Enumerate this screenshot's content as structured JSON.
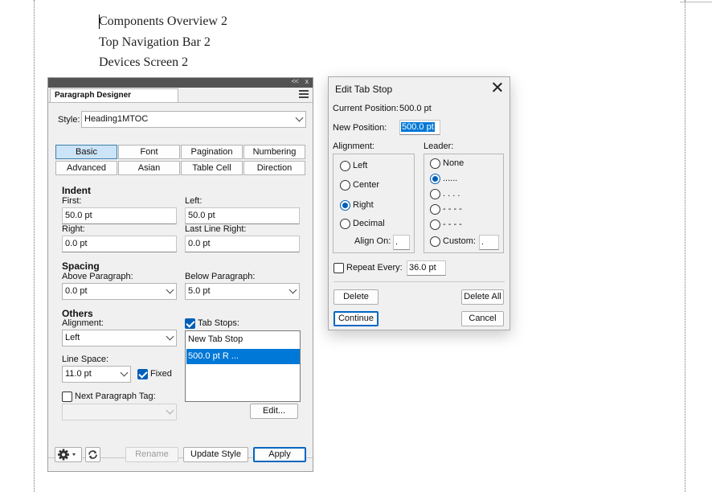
{
  "document": {
    "lines": [
      "Components Overview 2",
      "Top Navigation Bar 2",
      "Devices Screen 2"
    ]
  },
  "panel": {
    "tab_title": "Paragraph Designer",
    "grip_arrows": "<<",
    "grip_close": "x",
    "style_label": "Style:",
    "style_value": "Heading1MTOC",
    "tabs": [
      "Basic",
      "Font",
      "Pagination",
      "Numbering",
      "Advanced",
      "Asian",
      "Table Cell",
      "Direction"
    ],
    "active_tab": "Basic",
    "indent": {
      "heading": "Indent",
      "first_label": "First:",
      "first_value": "50.0 pt",
      "left_label": "Left:",
      "left_value": "50.0 pt",
      "right_label": "Right:",
      "right_value": "0.0 pt",
      "last_line_right_label": "Last Line Right:",
      "last_line_right_value": "0.0 pt"
    },
    "spacing": {
      "heading": "Spacing",
      "above_label": "Above Paragraph:",
      "above_value": "0.0 pt",
      "below_label": "Below Paragraph:",
      "below_value": "5.0 pt"
    },
    "others": {
      "heading": "Others",
      "alignment_label": "Alignment:",
      "alignment_value": "Left",
      "line_space_label": "Line Space:",
      "line_space_value": "11.0 pt",
      "fixed_label": "Fixed",
      "fixed_checked": true,
      "next_tag_label": "Next Paragraph Tag:",
      "next_tag_checked": false,
      "next_tag_value": "",
      "tab_stops_label": "Tab Stops:",
      "tab_stops_checked": true,
      "tab_stops": [
        "New Tab Stop",
        "500.0 pt  R  ..."
      ],
      "selected_tab_stop": 1,
      "edit_button": "Edit..."
    },
    "footer": {
      "rename_button": "Rename",
      "update_style_button": "Update Style",
      "apply_button": "Apply"
    }
  },
  "dialog": {
    "title": "Edit Tab Stop",
    "current_position_label": "Current Position:",
    "current_position_value": "500.0 pt",
    "new_position_label": "New Position:",
    "new_position_value": "500.0 pt",
    "alignment_label": "Alignment:",
    "alignment_options": [
      "Left",
      "Center",
      "Right",
      "Decimal"
    ],
    "alignment_selected": "Right",
    "align_on_label": "Align On:",
    "align_on_value": ".",
    "leader_label": "Leader:",
    "leader_options": [
      "None",
      "......",
      ". . . .",
      "- - - -",
      "- - - -",
      "Custom:"
    ],
    "leader_selected": 1,
    "custom_value": ".",
    "repeat_every_label": "Repeat Every:",
    "repeat_every_checked": false,
    "repeat_every_value": "36.0 pt",
    "delete_button": "Delete",
    "delete_all_button": "Delete All",
    "continue_button": "Continue",
    "cancel_button": "Cancel"
  },
  "colors": {
    "accent": "#005fb8",
    "selection": "#0078d7",
    "panel_header": "#535353"
  }
}
